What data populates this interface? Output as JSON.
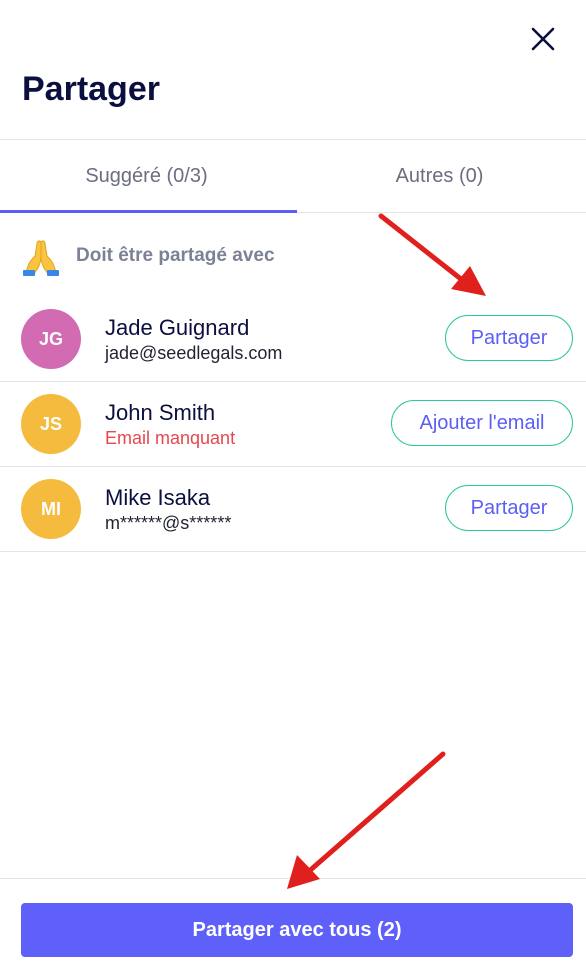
{
  "header": {
    "title": "Partager"
  },
  "tabs": [
    {
      "label": "Suggéré (0/3)",
      "active": true
    },
    {
      "label": "Autres (0)",
      "active": false
    }
  ],
  "notice": {
    "icon": "praying-hands-icon",
    "text": "Doit être partagé avec"
  },
  "contacts": [
    {
      "initials": "JG",
      "name": "Jade Guignard",
      "sub": "jade@seedlegals.com",
      "sub_status": "ok",
      "avatar_color": "#d36bb3",
      "action": "Partager"
    },
    {
      "initials": "JS",
      "name": "John Smith",
      "sub": "Email manquant",
      "sub_status": "missing",
      "avatar_color": "#f4bb3e",
      "action": "Ajouter l'email"
    },
    {
      "initials": "MI",
      "name": "Mike Isaka",
      "sub": "m******@s******",
      "sub_status": "ok",
      "avatar_color": "#f4bb3e",
      "action": "Partager"
    }
  ],
  "footer": {
    "share_all_label": "Partager avec tous (2)"
  },
  "colors": {
    "accent": "#5b5ef5",
    "button_border": "#2ec79b",
    "missing": "#e5484d",
    "annotation_arrow": "#e0201c"
  }
}
